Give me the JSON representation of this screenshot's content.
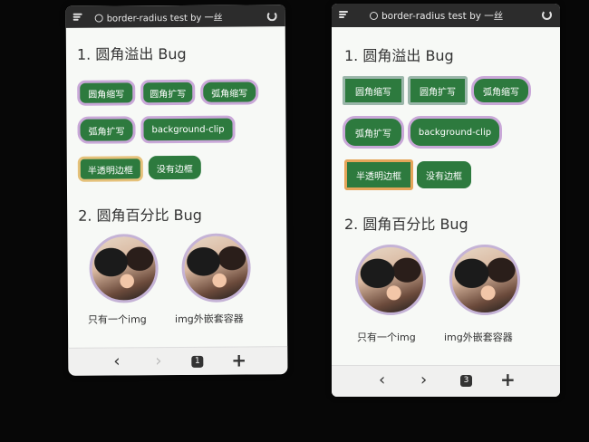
{
  "left": {
    "title": "border-radius test by 一丝",
    "section1": "1. 圆角溢出 Bug",
    "section2": "2. 圆角百分比 Bug",
    "buttons": [
      "圆角缩写",
      "圆角扩写",
      "弧角缩写",
      "弧角扩写",
      "background-clip",
      "半透明边框",
      "没有边框"
    ],
    "caption1": "只有一个img",
    "caption2": "img外嵌套容器",
    "tab_count": "1",
    "back": "‹",
    "forward": "›",
    "plus": "+"
  },
  "right": {
    "title": "border-radius test by 一丝",
    "section1": "1. 圆角溢出 Bug",
    "section2": "2. 圆角百分比 Bug",
    "buttons": [
      "圆角缩写",
      "圆角扩写",
      "弧角缩写",
      "弧角扩写",
      "background-clip",
      "半透明边框",
      "没有边框"
    ],
    "caption1": "只有一个img",
    "caption2": "img外嵌套容器",
    "tab_count": "3",
    "back": "‹",
    "forward": "›",
    "plus": "+"
  },
  "colors": {
    "button_green": "#2d7a3e",
    "purple_border": "#c9a8d8",
    "orange_border": "#e5c17a",
    "toolbar": "#2c2c2c"
  }
}
